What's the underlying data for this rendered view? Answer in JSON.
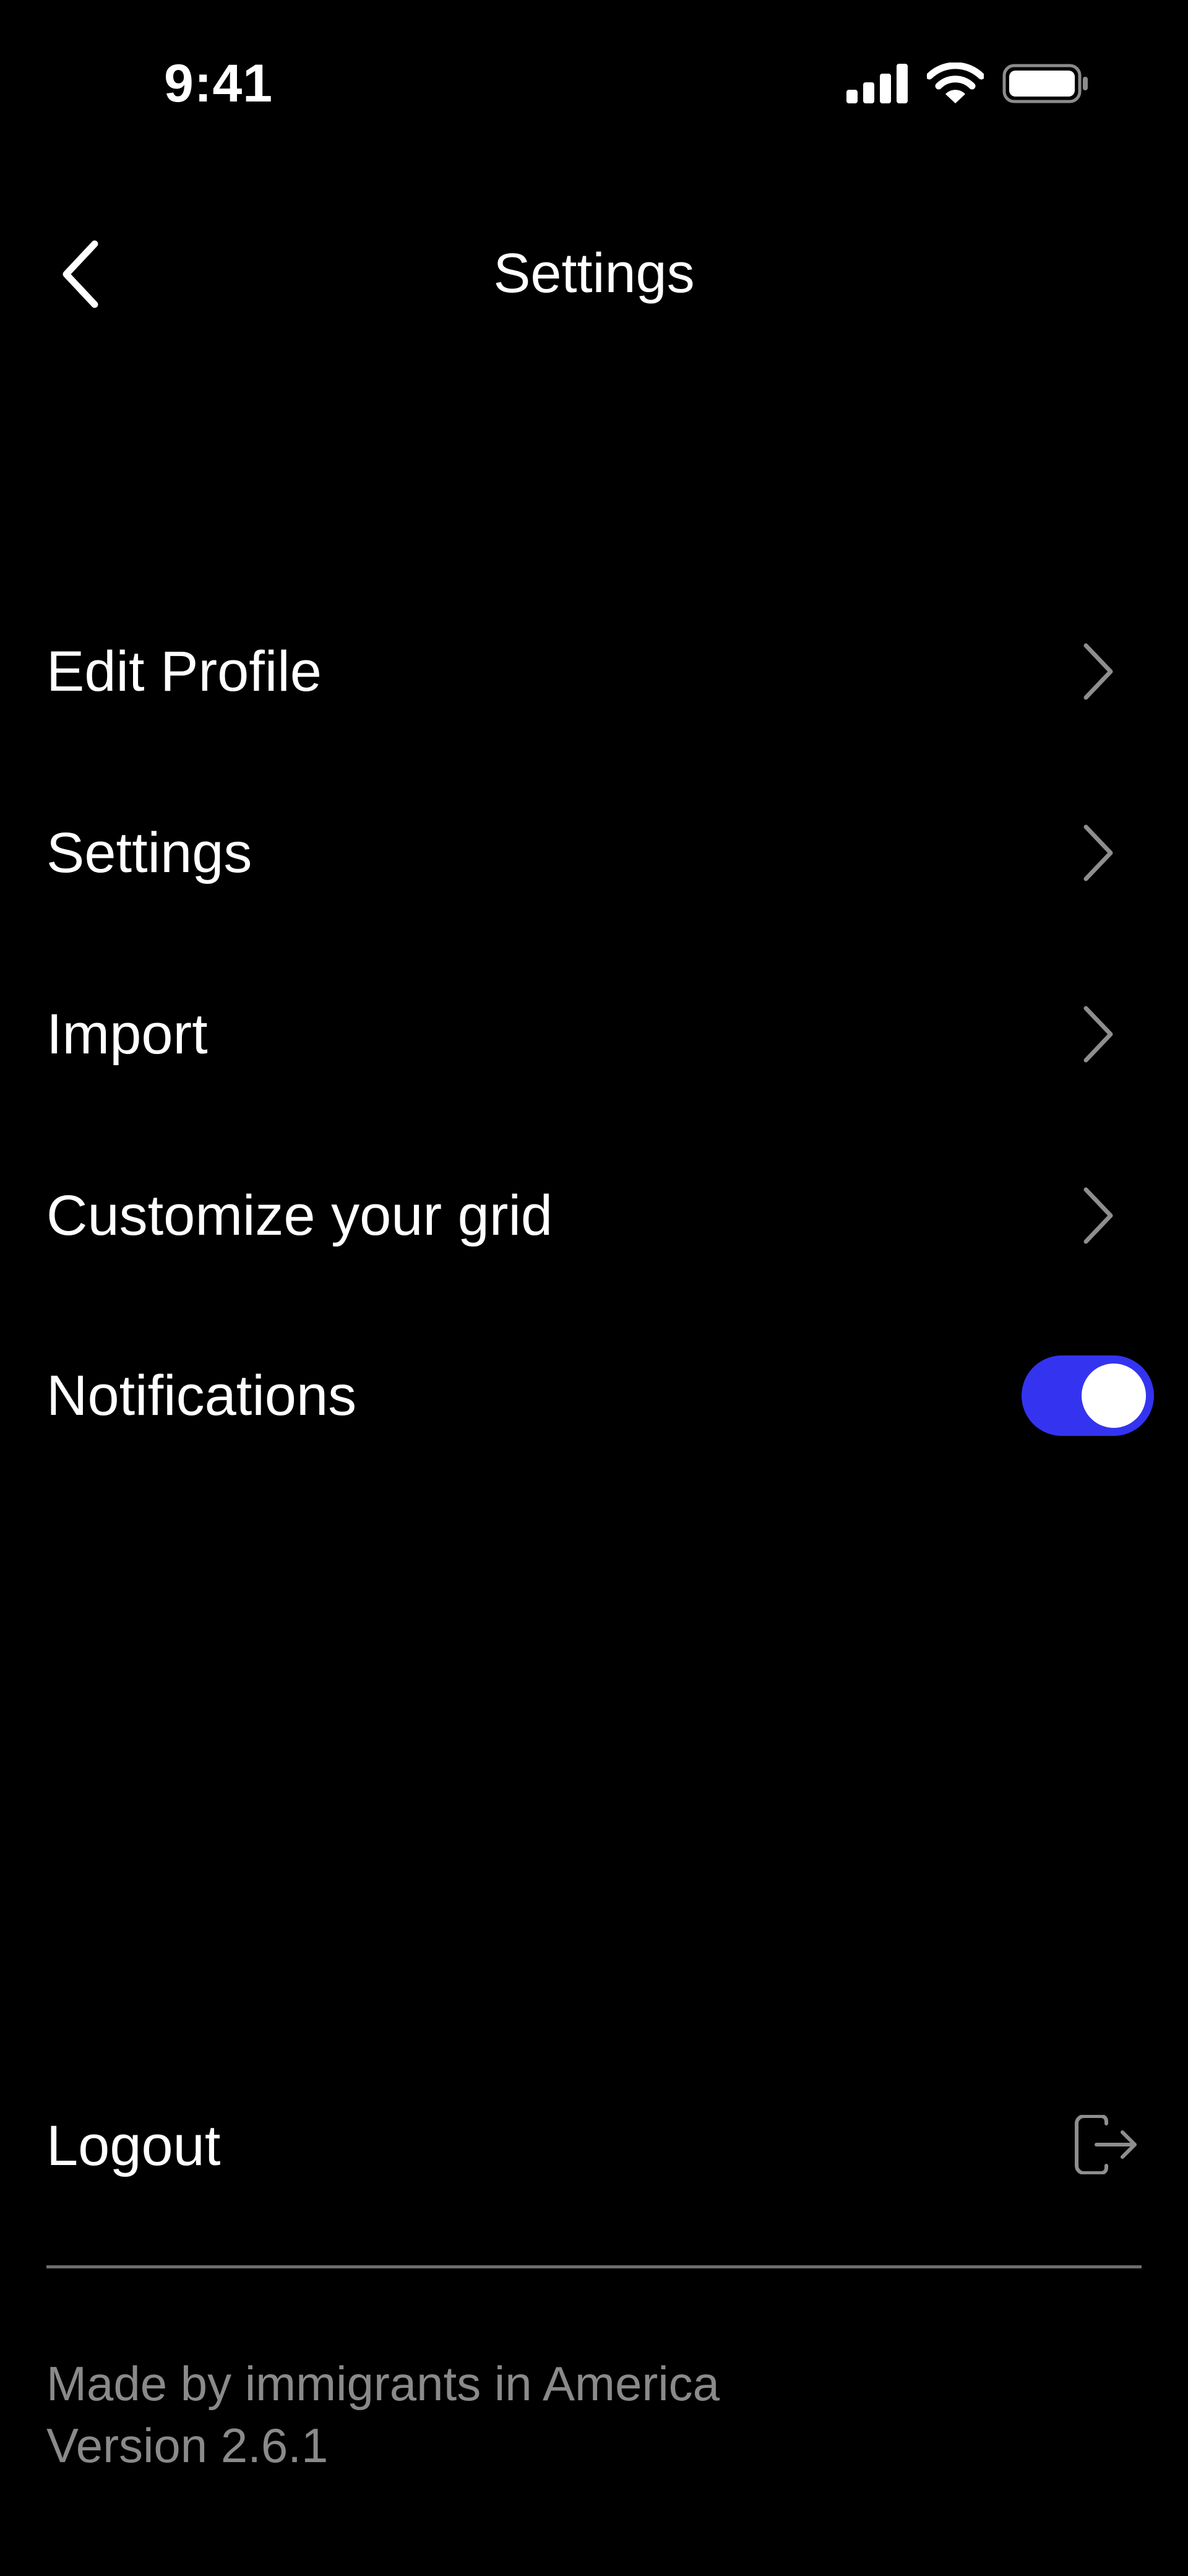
{
  "status_bar": {
    "time": "9:41",
    "icons": [
      "cellular-signal-icon",
      "wifi-icon",
      "battery-icon"
    ]
  },
  "nav": {
    "title": "Settings",
    "back_icon": "chevron-left-icon"
  },
  "menu": {
    "items": [
      {
        "label": "Edit Profile",
        "icon": "chevron-right-icon"
      },
      {
        "label": "Settings",
        "icon": "chevron-right-icon"
      },
      {
        "label": "Import",
        "icon": "chevron-right-icon"
      },
      {
        "label": "Customize your grid",
        "icon": "chevron-right-icon"
      }
    ],
    "notifications": {
      "label": "Notifications",
      "enabled": true
    }
  },
  "logout": {
    "label": "Logout",
    "icon": "logout-icon"
  },
  "footer": {
    "tagline": "Made by immigrants in America",
    "version": "Version 2.6.1"
  },
  "colors": {
    "background": "#000000",
    "text": "#ffffff",
    "muted_text": "#8a8a8a",
    "chevron": "#8e8e8e",
    "toggle_on": "#3434f0",
    "divider": "#6d6d6d"
  }
}
